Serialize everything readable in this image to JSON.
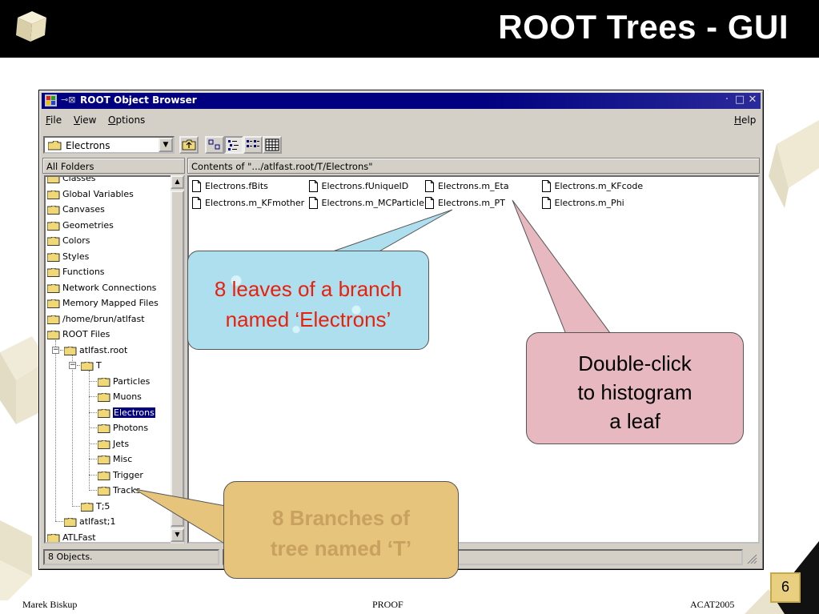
{
  "slide": {
    "title": "ROOT Trees - GUI",
    "footer_left": "Marek Biskup",
    "footer_center": "PROOF",
    "footer_right": "ACAT2005",
    "page_number": "6"
  },
  "window": {
    "title": "ROOT Object Browser",
    "menu": {
      "file": "File",
      "view": "View",
      "options": "Options",
      "help": "Help"
    },
    "combo_value": "Electrons",
    "left_header": "All Folders",
    "right_header": "Contents of \".../atlfast.root/T/Electrons\"",
    "tree": [
      "Classes",
      "Global Variables",
      "Canvases",
      "Geometries",
      "Colors",
      "Styles",
      "Functions",
      "Network Connections",
      "Memory Mapped Files",
      "/home/brun/atlfast",
      "ROOT Files",
      "atlfast.root",
      "T",
      "Particles",
      "Muons",
      "Electrons",
      "Photons",
      "Jets",
      "Misc",
      "Trigger",
      "Tracks",
      "T;5",
      "atlfast;1",
      "ATLFast"
    ],
    "leaves": [
      "Electrons.fBits",
      "Electrons.fUniqueID",
      "Electrons.m_Eta",
      "Electrons.m_KFcode",
      "Electrons.m_KFmother",
      "Electrons.m_MCParticle",
      "Electrons.m_PT",
      "Electrons.m_Phi"
    ],
    "status": "8 Objects."
  },
  "callouts": {
    "blue_line1": "8 leaves of a branch",
    "blue_line2": "named ‘Electrons’",
    "pink_line1": "Double-click",
    "pink_line2": "to histogram",
    "pink_line3": "a leaf",
    "gold_line1": "8 Branches of",
    "gold_line2": "tree named ‘T’"
  },
  "colors": {
    "header_bg": "#000000",
    "titlebar": "#000080",
    "blue_callout": "#aedfee",
    "pink_callout": "#e8b8c0",
    "gold_callout": "#e6c47c",
    "blue_text": "#e8200c"
  }
}
